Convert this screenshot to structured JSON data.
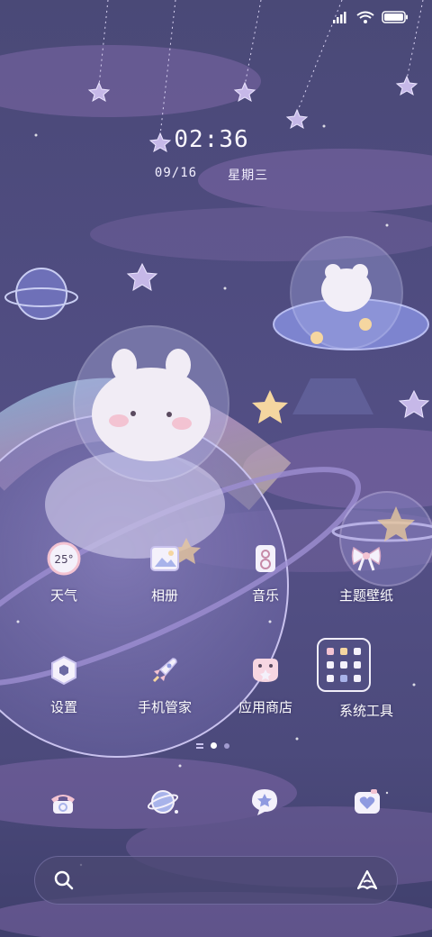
{
  "status_bar": {
    "signal_icon": "signal-icon",
    "wifi_icon": "wifi-icon",
    "battery_icon": "battery-icon",
    "battery_level": 0.95
  },
  "lock_widget": {
    "time": "02:36",
    "date": "09/16",
    "weekday": "星期三"
  },
  "apps": [
    {
      "label": "天气",
      "icon": "weather-icon",
      "temperature": "25°"
    },
    {
      "label": "相册",
      "icon": "gallery-icon"
    },
    {
      "label": "音乐",
      "icon": "music-icon"
    },
    {
      "label": "主题壁纸",
      "icon": "theme-bow-icon"
    },
    {
      "label": "设置",
      "icon": "settings-icon"
    },
    {
      "label": "手机管家",
      "icon": "security-rocket-icon"
    },
    {
      "label": "应用商店",
      "icon": "app-store-icon"
    },
    {
      "label": "系统工具",
      "icon": "system-tools-folder-icon"
    }
  ],
  "page_indicator": {
    "pages": 3,
    "current": 2
  },
  "dock": [
    {
      "icon": "phone-icon"
    },
    {
      "icon": "browser-planet-icon"
    },
    {
      "icon": "messages-star-icon"
    },
    {
      "icon": "camera-heart-icon"
    }
  ],
  "search_bar": {
    "search_icon": "search-icon",
    "assistant_icon": "assistant-icon"
  },
  "colors": {
    "background": "#4f4c80",
    "cloud": "#8a6fb0",
    "icon_fill": "#f4f1fb",
    "accent_pink": "#f3c3d2",
    "accent_yellow": "#f5d6a0"
  }
}
